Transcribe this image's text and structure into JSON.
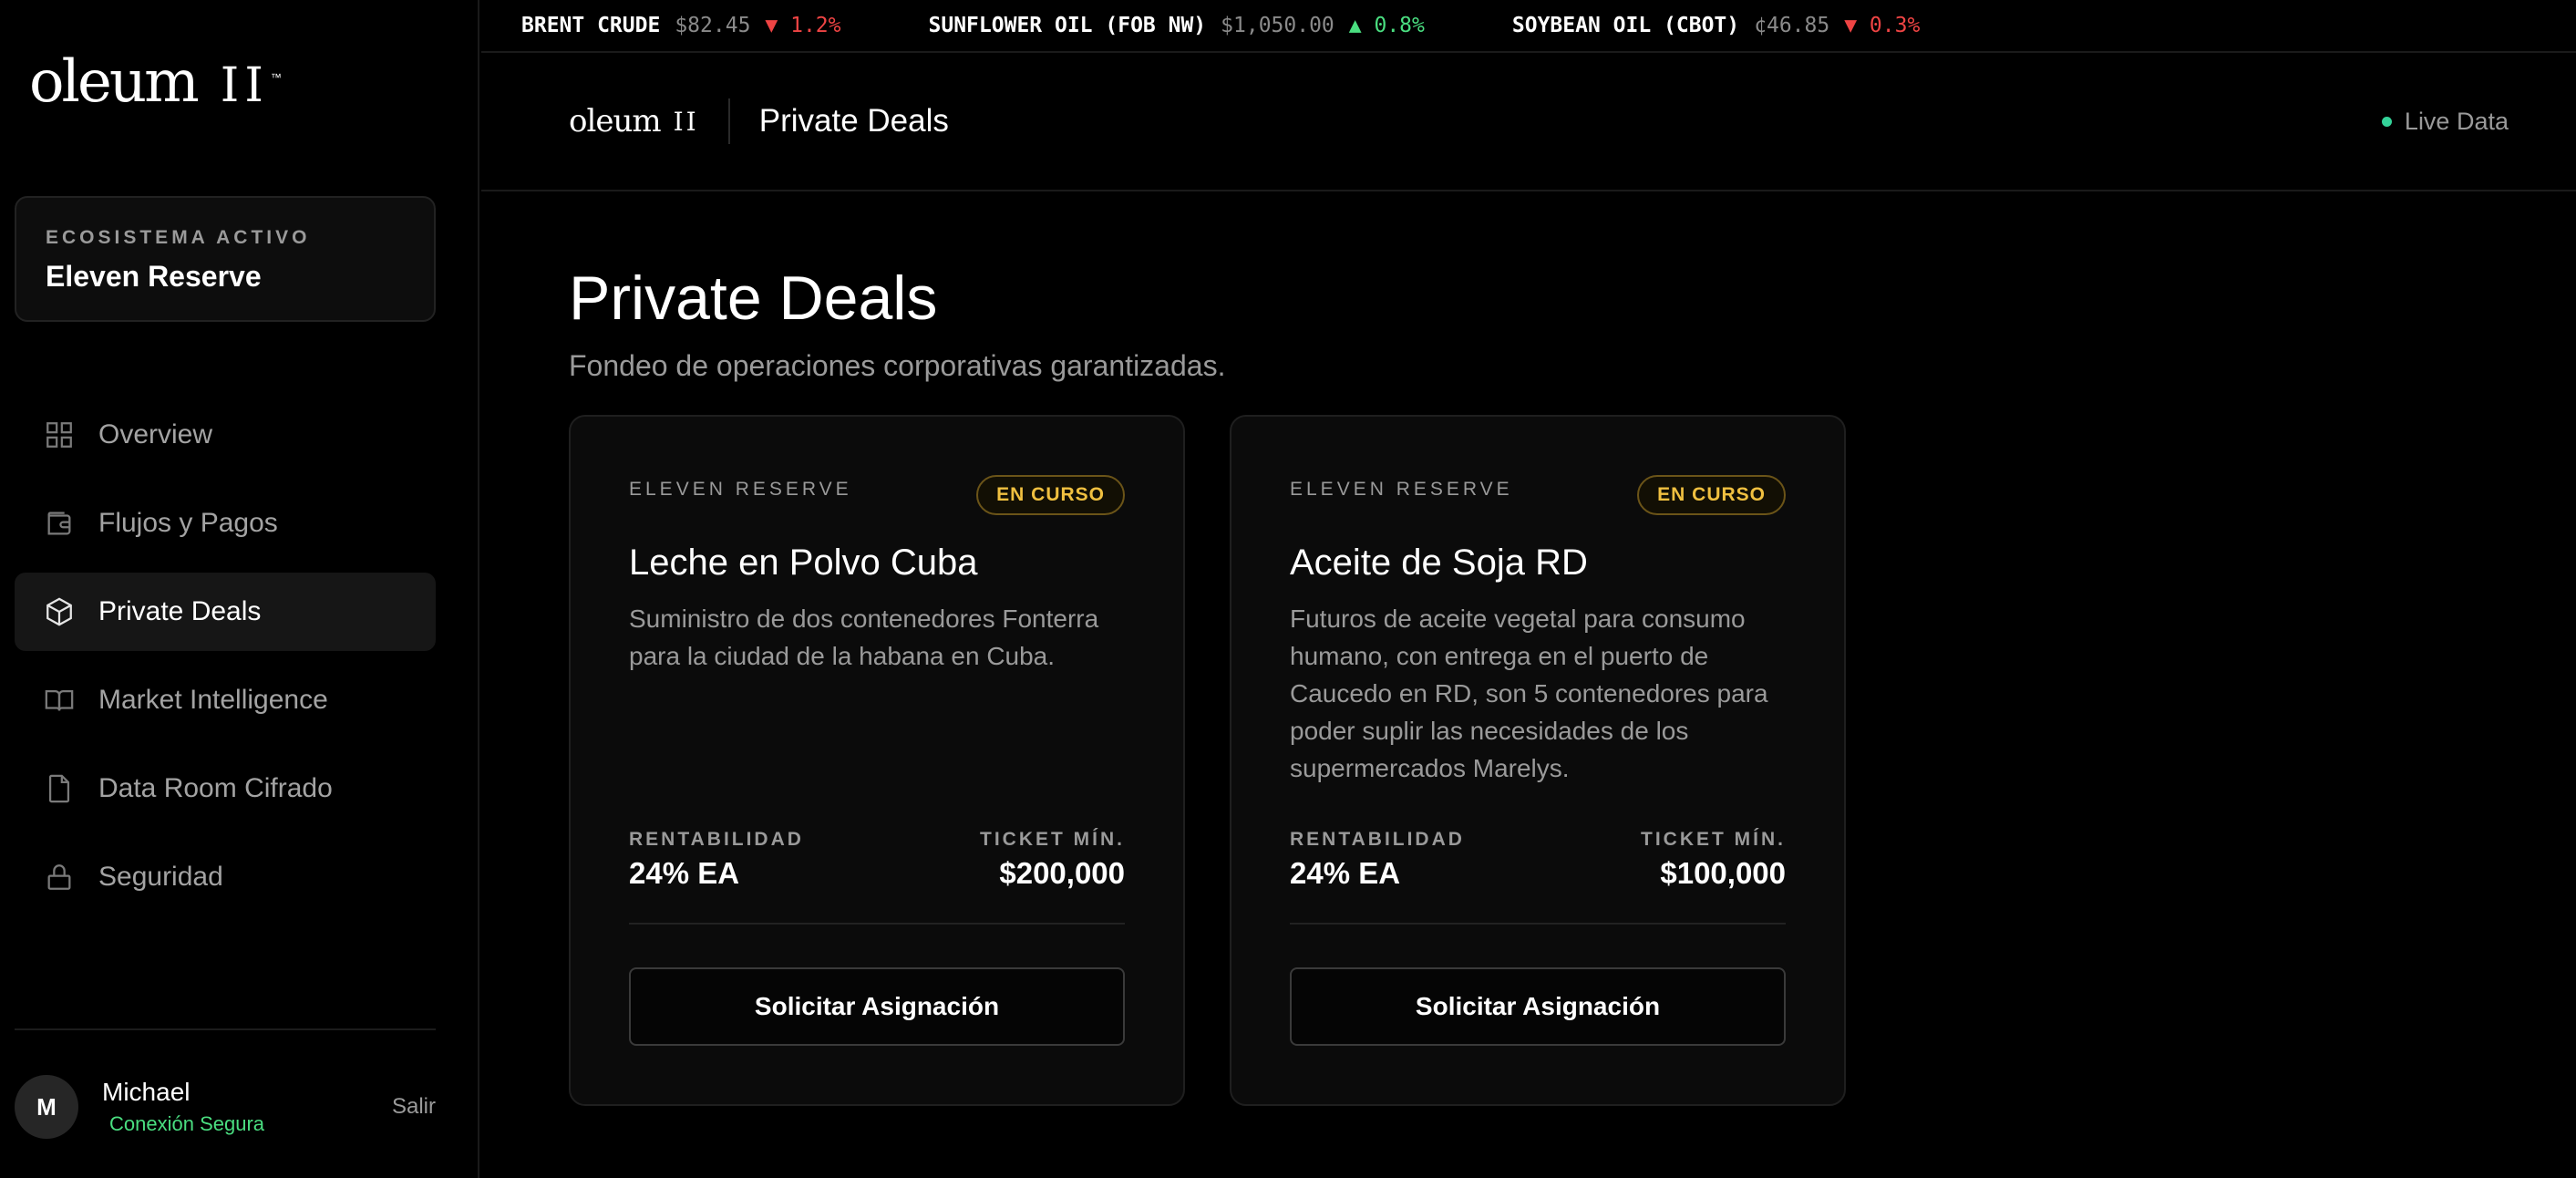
{
  "brand": {
    "word": "oleum",
    "mark": "II",
    "tm": "™"
  },
  "ecosystem": {
    "label": "ECOSISTEMA ACTIVO",
    "name": "Eleven Reserve"
  },
  "nav": [
    {
      "label": "Overview",
      "icon": "grid-icon"
    },
    {
      "label": "Flujos y Pagos",
      "icon": "wallet-icon"
    },
    {
      "label": "Private Deals",
      "icon": "box-icon",
      "active": true
    },
    {
      "label": "Market Intelligence",
      "icon": "book-icon"
    },
    {
      "label": "Data Room Cifrado",
      "icon": "file-icon"
    },
    {
      "label": "Seguridad",
      "icon": "lock-icon"
    }
  ],
  "user": {
    "initial": "M",
    "name": "Michael",
    "status": "Conexión Segura",
    "logout": "Salir"
  },
  "ticker": [
    {
      "name": "BRENT CRUDE",
      "price": "$82.45",
      "change": "▼ 1.2%",
      "direction": "down"
    },
    {
      "name": "SUNFLOWER OIL (FOB NW)",
      "price": "$1,050.00",
      "change": "▲ 0.8%",
      "direction": "up"
    },
    {
      "name": "SOYBEAN OIL (CBOT)",
      "price": "¢46.85",
      "change": "▼ 0.3%",
      "direction": "down"
    }
  ],
  "header": {
    "title": "Private Deals",
    "live": "Live Data"
  },
  "page": {
    "title": "Private Deals",
    "subtitle": "Fondeo de operaciones corporativas garantizadas."
  },
  "deals": [
    {
      "ecosystem": "ELEVEN RESERVE",
      "status": "EN CURSO",
      "title": "Leche en Polvo Cuba",
      "description": "Suministro de dos contenedores Fonterra para la ciudad de la habana en Cuba.",
      "yield_label": "RENTABILIDAD",
      "yield": "24% EA",
      "ticket_label": "TICKET MÍN.",
      "ticket": "$200,000",
      "cta": "Solicitar Asignación"
    },
    {
      "ecosystem": "ELEVEN RESERVE",
      "status": "EN CURSO",
      "title": "Aceite de Soja RD",
      "description": "Futuros de aceite vegetal para consumo humano, con entrega en el puerto de Caucedo en RD, son 5 contenedores para poder suplir las necesidades de los supermercados Marelys.",
      "yield_label": "RENTABILIDAD",
      "yield": "24% EA",
      "ticket_label": "TICKET MÍN.",
      "ticket": "$100,000",
      "cta": "Solicitar Asignación"
    }
  ],
  "colors": {
    "accent_gold": "#f0c040",
    "positive": "#4ade80",
    "negative": "#ef4444",
    "live": "#34d399"
  }
}
